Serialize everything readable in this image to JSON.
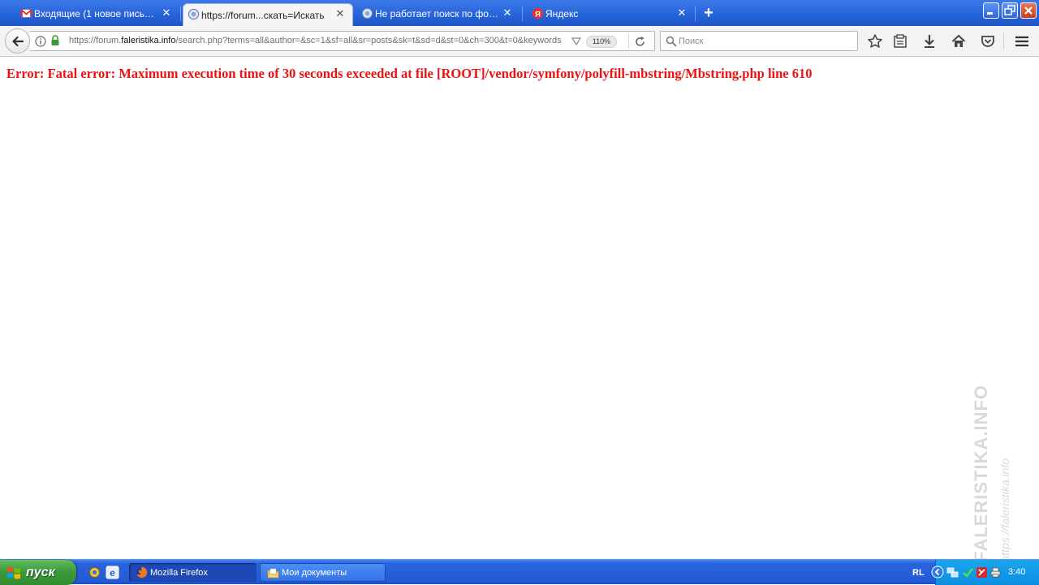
{
  "browser": {
    "tabs": [
      {
        "title": "Входящие (1 новое письмо) ...",
        "favicon": "gmail-icon",
        "active": false
      },
      {
        "title": "https://forum...скать=Искать",
        "favicon": "forum-icon",
        "active": true
      },
      {
        "title": "Не работает поиск по фору...",
        "favicon": "forum-icon",
        "active": false
      },
      {
        "title": "Яндекс",
        "favicon": "yandex-icon",
        "active": false
      }
    ],
    "new_tab_label": "+",
    "url": {
      "prefix": "https://forum.",
      "host": "faleristika.info",
      "path": "/search.php?terms=all&author=&sc=1&sf=all&sr=posts&sk=t&sd=d&st=0&ch=300&t=0&keywords"
    },
    "zoom": "110%",
    "search_placeholder": "Поиск"
  },
  "content": {
    "error": "Error: Fatal error: Maximum execution time of 30 seconds exceeded at file [ROOT]/vendor/symfony/polyfill-mbstring/Mbstring.php line 610"
  },
  "watermark": {
    "brand": "FALERISTIKA.INFO",
    "url": "https://faleristika.info"
  },
  "taskbar": {
    "start_label": "пуск",
    "tasks": [
      {
        "label": "Mozilla Firefox",
        "icon": "firefox-icon",
        "active": true
      },
      {
        "label": "Мои документы",
        "icon": "folder-icon",
        "active": false
      }
    ],
    "language": "RL",
    "clock": "3:40"
  },
  "colors": {
    "error_text": "#ee1111",
    "titlebar_blue": "#2563d9",
    "start_green": "#3a9a3a"
  }
}
